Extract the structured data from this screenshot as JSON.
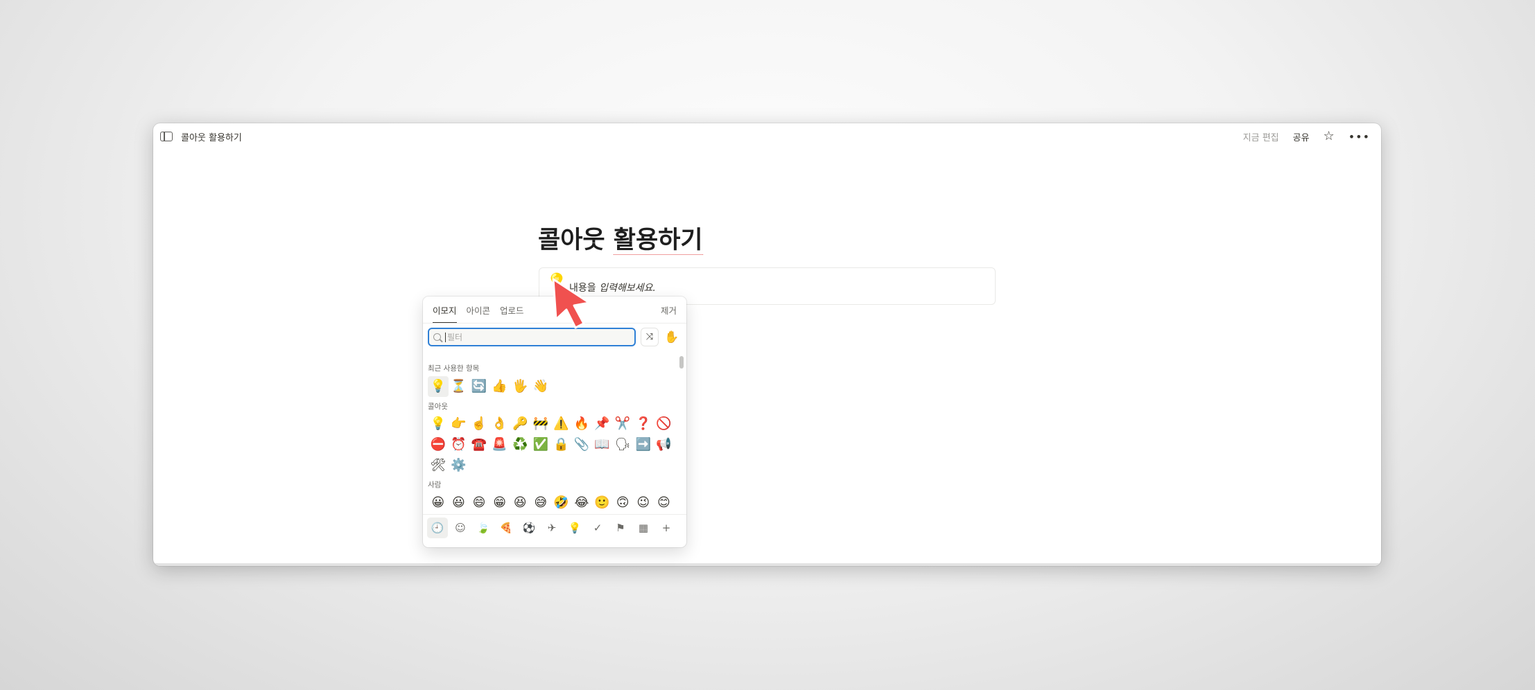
{
  "topbar": {
    "breadcrumb": "콜아웃 활용하기",
    "edited": "지금 편집",
    "share": "공유"
  },
  "page": {
    "title_part1": "콜아웃 ",
    "title_part2": "활용하기",
    "callout_icon": "💡",
    "callout_text_plain": "내용을 ",
    "callout_text_italic": "입력해보세요."
  },
  "picker": {
    "tabs": [
      "이모지",
      "아이콘",
      "업로드"
    ],
    "remove": "제거",
    "search_placeholder": "필터",
    "shuffle_icon": "⤨",
    "skin_icon": "✋",
    "sections": [
      {
        "label": "최근 사용한 항목",
        "emojis": [
          "💡",
          "⏳",
          "🔄",
          "👍",
          "🖐",
          "👋"
        ]
      },
      {
        "label": "콜아웃",
        "emojis": [
          "💡",
          "👉",
          "☝️",
          "👌",
          "🔑",
          "🚧",
          "⚠️",
          "🔥",
          "📌",
          "✂️",
          "❓",
          "🚫",
          "⛔",
          "⏰",
          "☎️",
          "🚨",
          "♻️",
          "✅",
          "🔒",
          "📎",
          "📖",
          "🗣",
          "➡️",
          "📢",
          "🛠",
          "⚙️"
        ]
      },
      {
        "label": "사람",
        "emojis": [
          "😀",
          "😃",
          "😄",
          "😁",
          "😆",
          "😅",
          "🤣",
          "😂",
          "🙂",
          "🙃",
          "😉",
          "😊"
        ]
      }
    ],
    "categories": [
      "🕘",
      "☺",
      "🍃",
      "🍕",
      "⚽",
      "✈",
      "💡",
      "✓",
      "⚑",
      "▦",
      "+"
    ]
  },
  "colors": {
    "accent": "#2f80d6",
    "cursor": "#f0514f"
  }
}
